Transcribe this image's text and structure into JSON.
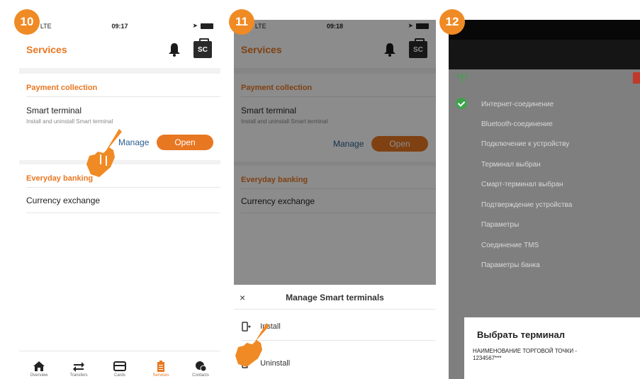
{
  "steps": [
    "10",
    "11",
    "12"
  ],
  "status": {
    "carrier": "T LTE",
    "time_10": "09:17",
    "time_11": "09:18"
  },
  "services": {
    "title": "Services",
    "sc_label": "SC",
    "payment_collection": "Payment collection",
    "smart_terminal": "Smart terminal",
    "smart_terminal_desc": "Install and uninstall Smart terminal",
    "manage": "Manage",
    "open": "Open",
    "everyday_banking": "Everyday banking",
    "currency_exchange": "Currency exchange"
  },
  "tabbar": [
    "Overview",
    "Transfers",
    "Cards",
    "Services",
    "Contacts"
  ],
  "sheet": {
    "title": "Manage Smart terminals",
    "close": "×",
    "install": "Install",
    "uninstall": "Uninstall"
  },
  "terminal": {
    "items": [
      "Интернет-соединение",
      "Bluetooth-соединение",
      "Подключение к устройству",
      "Терминал выбран",
      "Смарт-терминал выбран",
      "Подтверждение устройства",
      "Параметры",
      "Соединение TMS",
      "Параметры банка"
    ],
    "dialog_title": "Выбрать терминал",
    "dialog_value": "НАИМЕНОВАНИЕ ТОРГОВОЙ ТОЧКИ -",
    "dialog_value2": "1234567***"
  },
  "colors": {
    "accent": "#e87722",
    "badge": "#f08a24",
    "link": "#2a5d8f",
    "ok": "#3fa34d"
  }
}
